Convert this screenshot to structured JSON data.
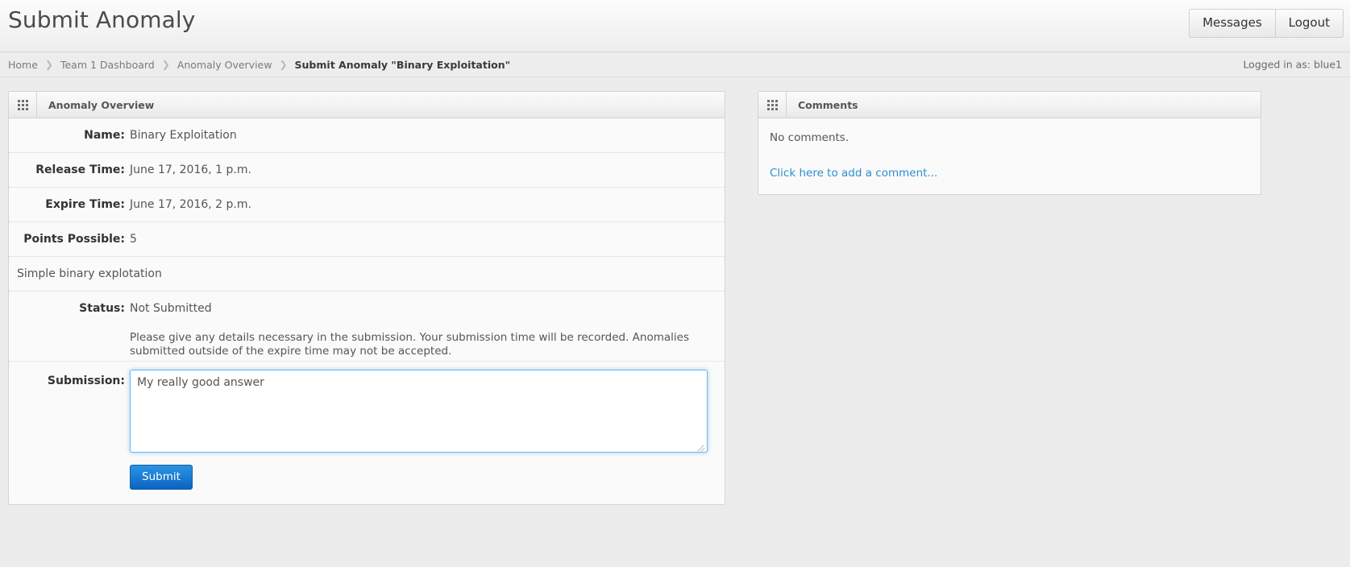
{
  "header": {
    "title": "Submit Anomaly",
    "buttons": [
      {
        "label": "Messages",
        "name": "messages-button"
      },
      {
        "label": "Logout",
        "name": "logout-button"
      }
    ]
  },
  "breadcrumb": {
    "items": [
      {
        "label": "Home",
        "active": false
      },
      {
        "label": "Team 1 Dashboard",
        "active": false
      },
      {
        "label": "Anomaly Overview",
        "active": false
      },
      {
        "label": "Submit Anomaly \"Binary Exploitation\"",
        "active": true
      }
    ],
    "separator": "❯",
    "logged_in_as": "Logged in as: blue1"
  },
  "anomaly_panel": {
    "title": "Anomaly Overview",
    "icon": "grid-icon",
    "rows": [
      {
        "label": "Name:",
        "value": "Binary Exploitation"
      },
      {
        "label": "Release Time:",
        "value": "June 17, 2016, 1 p.m."
      },
      {
        "label": "Expire Time:",
        "value": "June 17, 2016, 2 p.m."
      },
      {
        "label": "Points Possible:",
        "value": "5"
      }
    ],
    "description": "Simple binary explotation",
    "status_label": "Status:",
    "status_value": "Not Submitted",
    "help_text": "Please give any details necessary in the submission. Your submission time will be recorded. Anomalies submitted outside of the expire time may not be accepted.",
    "submission_label": "Submission:",
    "submission_value": "My really good answer",
    "submission_placeholder": "",
    "submit_button": "Submit"
  },
  "comments_panel": {
    "title": "Comments",
    "icon": "grid-icon",
    "empty_text": "No comments.",
    "add_link": "Click here to add a comment..."
  },
  "colors": {
    "accent": "#2a8fd4",
    "submit_button": "#1d7fd4",
    "focus_border": "#6cb6f0",
    "page_bg": "#ececec",
    "panel_bg": "#fafafa"
  }
}
